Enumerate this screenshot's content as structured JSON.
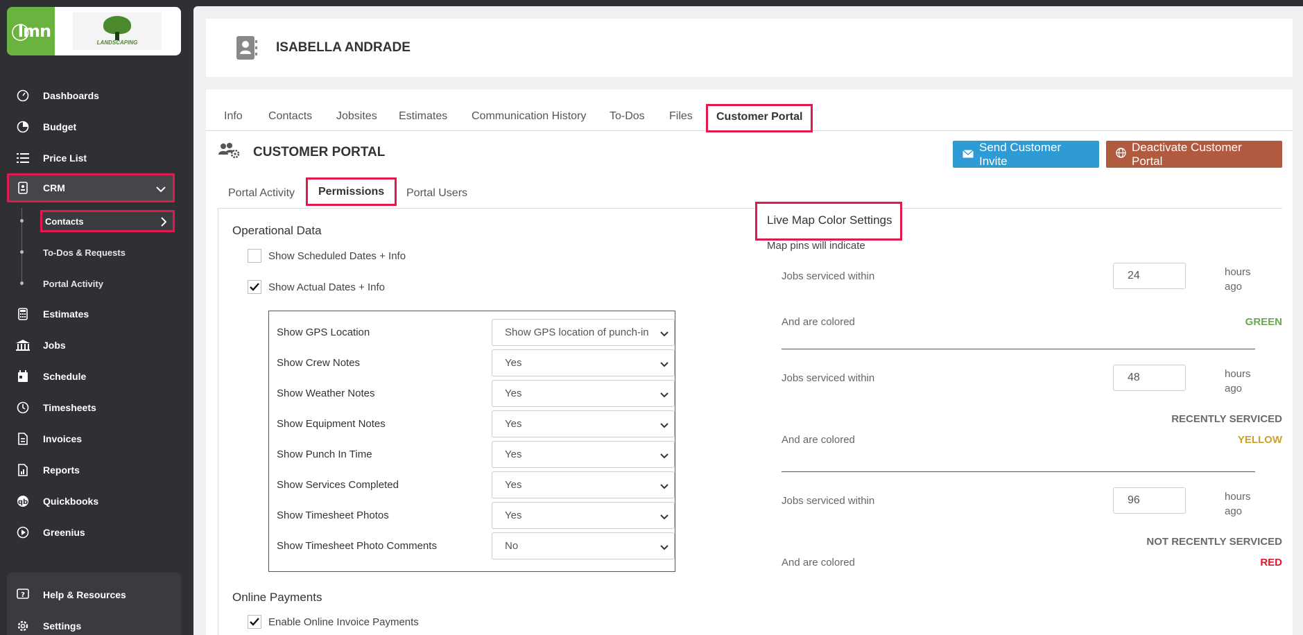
{
  "sidebar": {
    "logo_text": "lmn",
    "company_logo_text": "LANDSCAPING",
    "items": [
      {
        "label": "Dashboards",
        "icon": "gauge-icon"
      },
      {
        "label": "Budget",
        "icon": "pie-chart-icon"
      },
      {
        "label": "Price List",
        "icon": "list-icon"
      },
      {
        "label": "CRM",
        "icon": "contact-book-icon"
      },
      {
        "label": "Estimates",
        "icon": "calculator-icon"
      },
      {
        "label": "Jobs",
        "icon": "building-icon"
      },
      {
        "label": "Schedule",
        "icon": "calendar-icon"
      },
      {
        "label": "Timesheets",
        "icon": "clock-icon"
      },
      {
        "label": "Invoices",
        "icon": "invoice-icon"
      },
      {
        "label": "Reports",
        "icon": "report-icon"
      },
      {
        "label": "Quickbooks",
        "icon": "quickbooks-icon"
      },
      {
        "label": "Greenius",
        "icon": "play-circle-icon"
      }
    ],
    "crm_sub": [
      "Contacts",
      "To-Dos & Requests",
      "Portal Activity"
    ],
    "bottom": [
      {
        "label": "Help & Resources",
        "icon": "help-icon"
      },
      {
        "label": "Settings",
        "icon": "gear-icon"
      }
    ]
  },
  "header": {
    "name": "ISABELLA ANDRADE"
  },
  "tabs": [
    "Info",
    "Contacts",
    "Jobsites",
    "Estimates",
    "Communication History",
    "To-Dos",
    "Files",
    "Customer Portal"
  ],
  "portal": {
    "title": "CUSTOMER PORTAL",
    "invite_label": "Send Customer Invite",
    "deactivate_label": "Deactivate Customer Portal",
    "subtabs": [
      "Portal Activity",
      "Permissions",
      "Portal Users"
    ]
  },
  "operational": {
    "title": "Operational Data",
    "scheduled_label": "Show Scheduled Dates + Info",
    "scheduled_checked": false,
    "actual_label": "Show Actual Dates + Info",
    "actual_checked": true,
    "options": [
      {
        "label": "Show GPS Location",
        "value": "Show GPS location of punch-in"
      },
      {
        "label": "Show Crew Notes",
        "value": "Yes"
      },
      {
        "label": "Show Weather Notes",
        "value": "Yes"
      },
      {
        "label": "Show Equipment Notes",
        "value": "Yes"
      },
      {
        "label": "Show Punch In Time",
        "value": "Yes"
      },
      {
        "label": "Show Services Completed",
        "value": "Yes"
      },
      {
        "label": "Show Timesheet Photos",
        "value": "Yes"
      },
      {
        "label": "Show Timesheet Photo Comments",
        "value": "No"
      }
    ]
  },
  "payments": {
    "title": "Online Payments",
    "enable_label": "Enable Online Invoice Payments",
    "enable_checked": true
  },
  "map": {
    "title": "Live Map Color Settings",
    "subtitle": "Map pins will indicate",
    "jobs_label": "Jobs serviced within",
    "hours_label_1": "hours",
    "hours_label_2": "ago",
    "colored_label": "And are colored",
    "groups": [
      {
        "hours": "24",
        "status": "",
        "color_name": "GREEN",
        "color": "#6aa84f"
      },
      {
        "hours": "48",
        "status": "RECENTLY SERVICED",
        "color_name": "YELLOW",
        "color": "#c9a227"
      },
      {
        "hours": "96",
        "status": "NOT RECENTLY SERVICED",
        "color_name": "RED",
        "color": "#e0192a"
      }
    ]
  },
  "colors": {
    "accent_red": "#e2194e",
    "invite_blue": "#2f9bd4",
    "deactivate_brown": "#b05a3f",
    "brand_green": "#6bb33f"
  }
}
